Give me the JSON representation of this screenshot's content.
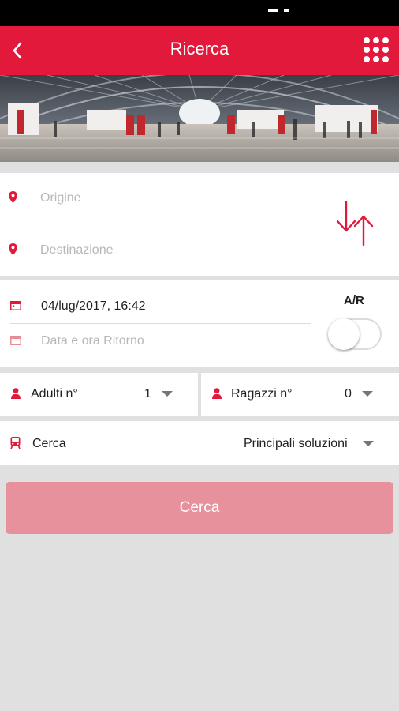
{
  "app": {
    "title": "Ricerca"
  },
  "icons": {
    "back": "chevron-left-icon",
    "menu": "grid-menu-icon",
    "origin": "location-pin-icon",
    "destination": "location-pin-icon",
    "swap": "swap-arrows-icon",
    "departure_date": "calendar-icon",
    "return_date": "calendar-icon",
    "adults": "person-icon",
    "children": "person-icon",
    "search_type": "train-icon"
  },
  "colors": {
    "brand": "#e2193a",
    "button_disabled": "#e6919c",
    "hint": "#b8b8b8",
    "background": "#e0e0e0"
  },
  "route": {
    "origin_placeholder": "Origine",
    "destination_placeholder": "Destinazione"
  },
  "dates": {
    "departure_value": "04/lug/2017, 16:42",
    "return_placeholder": "Data e ora Ritorno",
    "round_trip_label": "A/R",
    "round_trip_enabled": false
  },
  "passengers": {
    "adults_label": "Adulti n°",
    "adults_value": "1",
    "children_label": "Ragazzi n°",
    "children_value": "0"
  },
  "search_options": {
    "label": "Cerca",
    "value": "Principali soluzioni"
  },
  "actions": {
    "search_button": "Cerca"
  }
}
